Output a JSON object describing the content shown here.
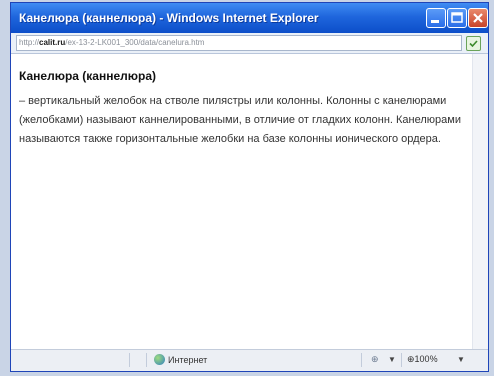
{
  "window": {
    "title": "Канелюра (каннелюра) - Windows Internet Explorer"
  },
  "address": {
    "prefix": "http://",
    "domain": "calit.ru",
    "rest": "/ex-13-2-LK001_300/data/canelura.htm"
  },
  "content": {
    "term": "Канелюра (каннелюра)",
    "definition": "– вертикальный желобок на стволе пилястры или колонны. Колонны с канелюрами (желобками) называют каннелированными, в отличие от гладких колонн. Канелюрами называются также горизонтальные желобки на базе колонны ионического ордера."
  },
  "status": {
    "zone": "Интернет",
    "zoom": "100%"
  },
  "icons": {
    "minimize": "minimize-icon",
    "maximize": "maximize-icon",
    "close": "close-icon",
    "zone": "globe-icon",
    "protected_mode": "protected-mode-icon"
  },
  "colors": {
    "titlebar": "#1f66dd",
    "close_button": "#c8432a"
  }
}
